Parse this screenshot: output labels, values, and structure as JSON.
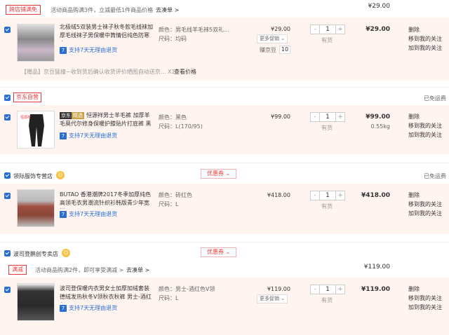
{
  "group1": {
    "tag": "跨店铺满免",
    "promo": "活动商品购满3件，立减最低1件商品价格",
    "link": "去凑单 >",
    "sum": "¥29.00"
  },
  "item1": {
    "title": "北极绒5双装男士袜子秋冬款毛线袜加厚毛线袜子男保暖中筒情侣纯色防寒女",
    "service": "支持7天无理由退货",
    "color": "颜色：男毛线羊毛袜5双礼...",
    "size": "尺码：均码",
    "price": "¥29.00",
    "more_promo": "更多促销",
    "qty": "1",
    "stock": "有货",
    "points_label": "赚京豆",
    "points": "10",
    "subtotal": "¥29.00",
    "ops": [
      "删除",
      "移到我的关注",
      "加到我的关注"
    ],
    "gift": "【赠品】京豆猛撞~收到货后确认收货评价晒图自动送京...",
    "gift_qty": "X1",
    "gift_link": "查看价格"
  },
  "shop2": {
    "name": "京东自营",
    "freight": "已免运费"
  },
  "item2": {
    "badge1": "京东",
    "badge2": "精选",
    "title": "恒源祥男士羊毛裤 加厚羊毛莫代尔修身保暖护膝贴片打底裤 黑",
    "service": "支持7天无理由退货",
    "color": "颜色：黑色",
    "size": "尺码：L(170/95)",
    "price": "¥99.00",
    "qty": "1",
    "stock": "有货",
    "subtotal": "¥99.00",
    "weight": "0.55kg",
    "ops": [
      "删除",
      "移到我的关注",
      "加到我的关注"
    ]
  },
  "shop3": {
    "name": "领际服饰专营店",
    "coupon": "优惠券 ⌄",
    "freight": "已免运费"
  },
  "item3": {
    "title": "BUTAO 香港潮牌2017冬季加厚纯色高领毛衣男潮流针织衫韩版青少年宽松",
    "service": "支持7天无理由退货",
    "color": "颜色：砖红色",
    "size": "尺码：L",
    "price": "¥418.00",
    "qty": "1",
    "stock": "有货",
    "subtotal": "¥418.00",
    "ops": [
      "删除",
      "移到我的关注",
      "加到我的关注"
    ]
  },
  "shop4": {
    "name": "波司登鹏创专卖店",
    "coupon": "优惠券 ⌄"
  },
  "group4": {
    "tag": "满减",
    "promo": "活动商品购满2件，即可享受满减 >",
    "link": "去凑单 >",
    "sum": "¥119.00"
  },
  "item4": {
    "title": "波司登保暖内衣男女士加厚加绒套装德绒发热秋冬V领秋衣秋裤 男士-酒红色V",
    "service": "支持7天无理由退货",
    "color": "颜色：男士-酒红色V领",
    "size": "尺码：L",
    "price": "¥119.00",
    "more_promo": "更多促销",
    "qty": "1",
    "stock": "有货",
    "subtotal": "¥119.00",
    "ops": [
      "删除",
      "移到我的关注",
      "加到我的关注"
    ]
  },
  "common": {
    "minus": "-",
    "plus": "+",
    "svc_icon": "7"
  }
}
